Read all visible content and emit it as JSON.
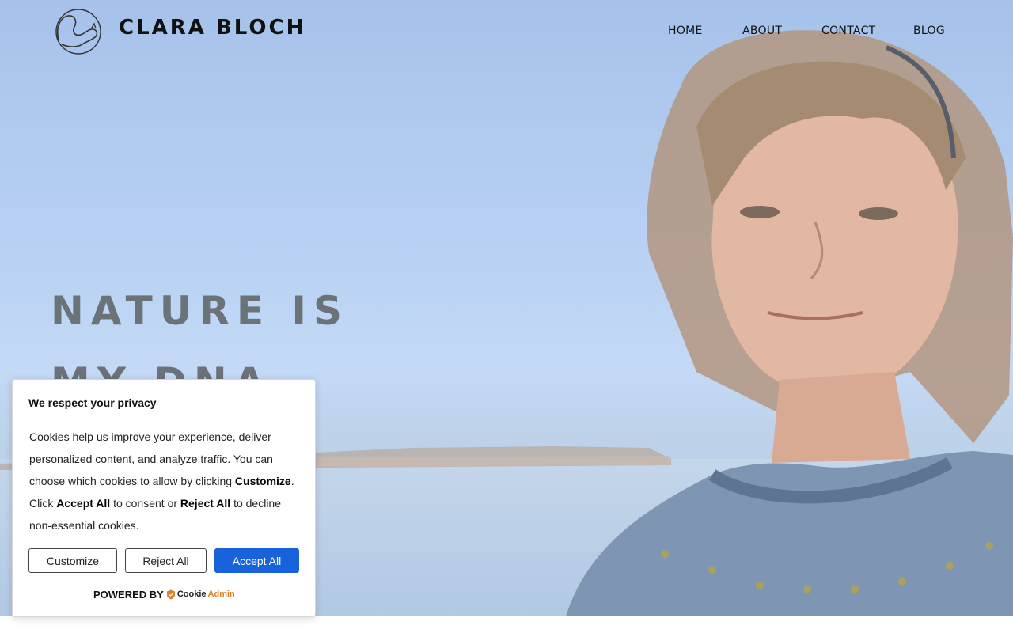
{
  "header": {
    "site_title": "CLARA BLOCH",
    "logo_icon": "squirrel-logo-icon",
    "nav": [
      {
        "label": "HOME"
      },
      {
        "label": "ABOUT"
      },
      {
        "label": "CONTACT"
      },
      {
        "label": "BLOG"
      }
    ]
  },
  "hero": {
    "headline": "NATURE IS MY DNA"
  },
  "cookie_banner": {
    "title": "We respect your privacy",
    "text_1": "Cookies help us improve your experience, deliver personalized content, and analyze traffic. You can choose which cookies to allow by clicking ",
    "bold_customize": "Customize",
    "text_2": ". Click ",
    "bold_accept": "Accept All",
    "text_3": " to consent or ",
    "bold_reject": "Reject All",
    "text_4": " to decline non-essential cookies.",
    "buttons": {
      "customize": "Customize",
      "reject": "Reject All",
      "accept": "Accept All"
    },
    "powered_by": "POWERED BY",
    "brand_part1": "Cookie",
    "brand_part2": "Admin",
    "accent_color": "#1863dc"
  }
}
